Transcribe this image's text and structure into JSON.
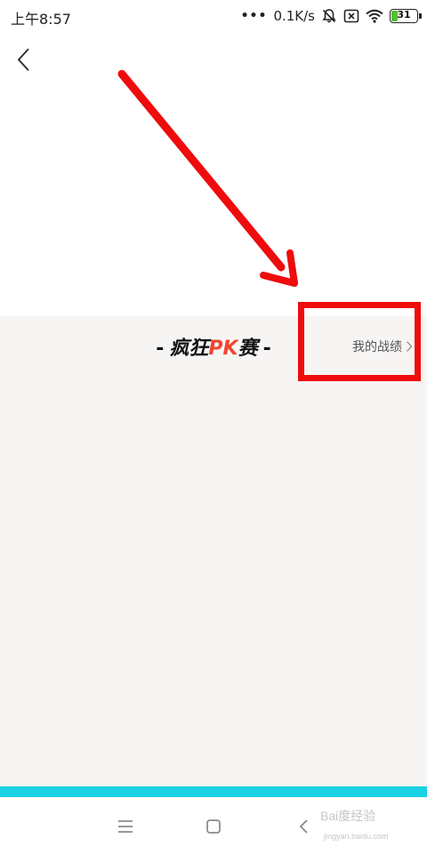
{
  "status_bar": {
    "time": "上午8:57",
    "dots": "•••",
    "speed": "0.1K/s",
    "battery_level": "31",
    "battery_fraction": 0.31,
    "battery_color": "#4fc22f"
  },
  "section": {
    "title_dash_left": "-",
    "title_main": "疯狂",
    "title_accent": "PK",
    "title_end": "赛",
    "title_dash_right": "-",
    "accent_color": "#f0452f",
    "my_record_label": "我的战绩"
  },
  "colors": {
    "content_bg": "#f7f5f4",
    "highlight": "#ee0c0c",
    "cyan_bar": "#19d2e6"
  },
  "watermark": {
    "text": "Bai度经验",
    "sub": "jingyan.baidu.com"
  }
}
